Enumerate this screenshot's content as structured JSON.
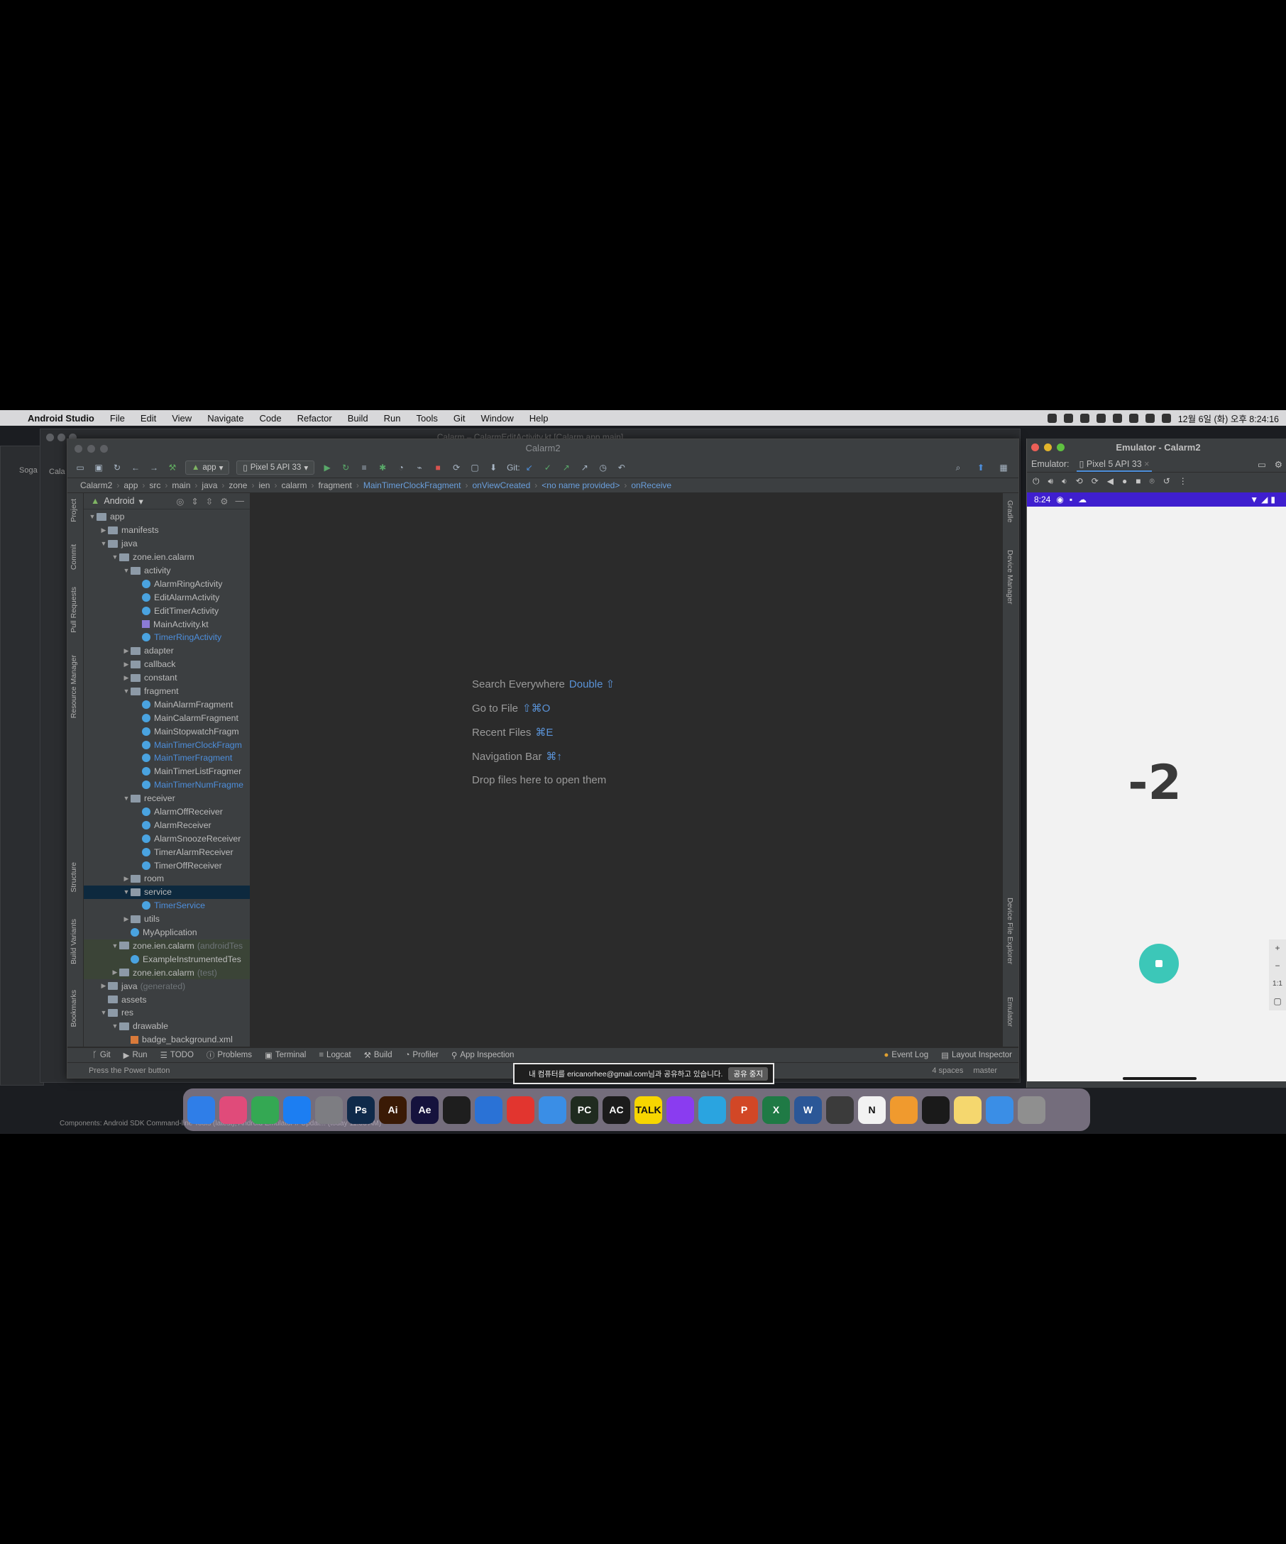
{
  "menubar": {
    "app": "Android Studio",
    "items": [
      "File",
      "Edit",
      "View",
      "Navigate",
      "Code",
      "Refactor",
      "Build",
      "Run",
      "Tools",
      "Git",
      "Window",
      "Help"
    ],
    "clock": "12월 6일 (화) 오후 8:24:16"
  },
  "back_windows": {
    "title": "Calarm – CalarmEditActivity.kt [Calarm.app.main]",
    "label_a": "Soga",
    "label_b": "Cala"
  },
  "ide": {
    "title": "Calarm2",
    "toolbar": {
      "run_config": "app",
      "device": "Pixel 5 API 33",
      "git_label": "Git:"
    },
    "breadcrumb": [
      "Calarm2",
      "app",
      "src",
      "main",
      "java",
      "zone",
      "ien",
      "calarm",
      "fragment",
      "MainTimerClockFragment",
      "onViewCreated",
      "<no name provided>",
      "onReceive"
    ],
    "left_tools": [
      "Project",
      "Commit",
      "Pull Requests",
      "Resource Manager",
      "Structure",
      "Build Variants",
      "Bookmarks"
    ],
    "right_tools": [
      "Gradle",
      "Device Manager",
      "Device File Explorer",
      "Emulator"
    ],
    "project_view": "Android",
    "tree": [
      {
        "label": "app",
        "depth": 0,
        "arrow": "v",
        "icon": "folder"
      },
      {
        "label": "manifests",
        "depth": 1,
        "arrow": ">",
        "icon": "folder"
      },
      {
        "label": "java",
        "depth": 1,
        "arrow": "v",
        "icon": "folder"
      },
      {
        "label": "zone.ien.calarm",
        "depth": 2,
        "arrow": "v",
        "icon": "folder"
      },
      {
        "label": "activity",
        "depth": 3,
        "arrow": "v",
        "icon": "folder"
      },
      {
        "label": "AlarmRingActivity",
        "depth": 4,
        "icon": "class"
      },
      {
        "label": "EditAlarmActivity",
        "depth": 4,
        "icon": "class"
      },
      {
        "label": "EditTimerActivity",
        "depth": 4,
        "icon": "class"
      },
      {
        "label": "MainActivity.kt",
        "depth": 4,
        "icon": "kotlin"
      },
      {
        "label": "TimerRingActivity",
        "depth": 4,
        "icon": "class",
        "style": "blue"
      },
      {
        "label": "adapter",
        "depth": 3,
        "arrow": ">",
        "icon": "folder"
      },
      {
        "label": "callback",
        "depth": 3,
        "arrow": ">",
        "icon": "folder"
      },
      {
        "label": "constant",
        "depth": 3,
        "arrow": ">",
        "icon": "folder"
      },
      {
        "label": "fragment",
        "depth": 3,
        "arrow": "v",
        "icon": "folder"
      },
      {
        "label": "MainAlarmFragment",
        "depth": 4,
        "icon": "class"
      },
      {
        "label": "MainCalarmFragment",
        "depth": 4,
        "icon": "class"
      },
      {
        "label": "MainStopwatchFragm",
        "depth": 4,
        "icon": "class"
      },
      {
        "label": "MainTimerClockFragm",
        "depth": 4,
        "icon": "class",
        "style": "blue"
      },
      {
        "label": "MainTimerFragment",
        "depth": 4,
        "icon": "class",
        "style": "blue"
      },
      {
        "label": "MainTimerListFragmer",
        "depth": 4,
        "icon": "class"
      },
      {
        "label": "MainTimerNumFragme",
        "depth": 4,
        "icon": "class",
        "style": "blue"
      },
      {
        "label": "receiver",
        "depth": 3,
        "arrow": "v",
        "icon": "folder"
      },
      {
        "label": "AlarmOffReceiver",
        "depth": 4,
        "icon": "class"
      },
      {
        "label": "AlarmReceiver",
        "depth": 4,
        "icon": "class"
      },
      {
        "label": "AlarmSnoozeReceiver",
        "depth": 4,
        "icon": "class"
      },
      {
        "label": "TimerAlarmReceiver",
        "depth": 4,
        "icon": "class"
      },
      {
        "label": "TimerOffReceiver",
        "depth": 4,
        "icon": "class"
      },
      {
        "label": "room",
        "depth": 3,
        "arrow": ">",
        "icon": "folder"
      },
      {
        "label": "service",
        "depth": 3,
        "arrow": "v",
        "icon": "folder",
        "style": "sel"
      },
      {
        "label": "TimerService",
        "depth": 4,
        "icon": "class",
        "style": "blue"
      },
      {
        "label": "utils",
        "depth": 3,
        "arrow": ">",
        "icon": "folder"
      },
      {
        "label": "MyApplication",
        "depth": 3,
        "icon": "class"
      },
      {
        "label": "zone.ien.calarm",
        "suffix": "(androidTes",
        "depth": 2,
        "arrow": "v",
        "icon": "folder",
        "style": "test"
      },
      {
        "label": "ExampleInstrumentedTes",
        "depth": 3,
        "icon": "class",
        "style": "test"
      },
      {
        "label": "zone.ien.calarm",
        "suffix": "(test)",
        "depth": 2,
        "arrow": ">",
        "icon": "folder",
        "style": "test"
      },
      {
        "label": "java",
        "suffix": "(generated)",
        "depth": 1,
        "arrow": ">",
        "icon": "folder"
      },
      {
        "label": "assets",
        "depth": 1,
        "icon": "folder"
      },
      {
        "label": "res",
        "depth": 1,
        "arrow": "v",
        "icon": "folder"
      },
      {
        "label": "drawable",
        "depth": 2,
        "arrow": "v",
        "icon": "folder"
      },
      {
        "label": "badge_background.xml",
        "depth": 3,
        "icon": "xml"
      }
    ],
    "editor_hints": [
      {
        "text": "Search Everywhere",
        "key": "Double ⇧"
      },
      {
        "text": "Go to File",
        "key": "⇧⌘O"
      },
      {
        "text": "Recent Files",
        "key": "⌘E"
      },
      {
        "text": "Navigation Bar",
        "key": "⌘↑"
      },
      {
        "text": "Drop files here to open them",
        "key": ""
      }
    ],
    "bottom_tabs": [
      "Git",
      "Run",
      "TODO",
      "Problems",
      "Terminal",
      "Logcat",
      "Build",
      "Profiler",
      "App Inspection"
    ],
    "bottom_tabs_right": [
      "Event Log",
      "Layout Inspector"
    ],
    "status_left": "Press the Power button",
    "status_components": "Components: Android SDK Command-line Tools (latest), Android Emulator // Updat... (today 11:06 AM)",
    "status_right": [
      "4 spaces",
      "master"
    ]
  },
  "share_bar": {
    "text": "내 컴퓨터를 ericanorhee@gmail.com님과 공유하고 있습니다.",
    "stop_button": "공유 중지"
  },
  "emulator": {
    "title": "Emulator - Calarm2",
    "label": "Emulator:",
    "device_tab": "Pixel 5 API 33",
    "phone_time": "8:24",
    "timer_value": "-2",
    "zoom": [
      "+",
      "−",
      "1:1"
    ]
  },
  "dock": {
    "apps": [
      {
        "label": "",
        "color": "#2f7ee8"
      },
      {
        "label": "",
        "color": "#e04b7a"
      },
      {
        "label": "",
        "color": "#34a853"
      },
      {
        "label": "",
        "color": "#1c7ef2"
      },
      {
        "label": "",
        "color": "#7d7d82"
      },
      {
        "label": "Ps",
        "color": "#0f2a4a"
      },
      {
        "label": "Ai",
        "color": "#3a1a05"
      },
      {
        "label": "Ae",
        "color": "#15123d"
      },
      {
        "label": "",
        "color": "#1e1e1e"
      },
      {
        "label": "",
        "color": "#2a72d6"
      },
      {
        "label": "",
        "color": "#e2352f"
      },
      {
        "label": "",
        "color": "#3a8ee6"
      },
      {
        "label": "PC",
        "color": "#1f2b1f"
      },
      {
        "label": "AC",
        "color": "#1b1b1b"
      },
      {
        "label": "TALK",
        "color": "#f7d600"
      },
      {
        "label": "",
        "color": "#8a3cf0"
      },
      {
        "label": "",
        "color": "#2aa4e0"
      },
      {
        "label": "P",
        "color": "#d24726"
      },
      {
        "label": "X",
        "color": "#1f7a45"
      },
      {
        "label": "W",
        "color": "#2b5797"
      },
      {
        "label": "",
        "color": "#3b3b3b"
      },
      {
        "label": "N",
        "color": "#f2f2f2"
      },
      {
        "label": "",
        "color": "#f09a2e"
      },
      {
        "label": "",
        "color": "#1a1a1a"
      },
      {
        "label": "",
        "color": "#f5d76e"
      },
      {
        "label": "",
        "color": "#3a8ee6"
      },
      {
        "label": "",
        "color": "#8f8f8f"
      }
    ]
  },
  "colors": {
    "accent": "#4d8edb",
    "selection": "#0d293e",
    "fab": "#3cc7b8",
    "phone_status": "#3f1fcf"
  }
}
